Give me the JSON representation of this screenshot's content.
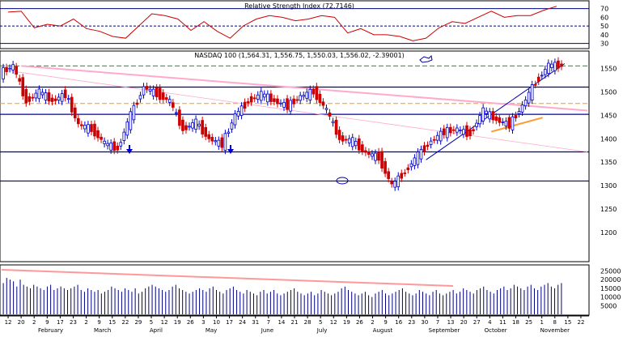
{
  "chart_data": [
    {
      "type": "line",
      "title": "Relative Strength Index (72.7146)",
      "ylim": [
        25,
        78
      ],
      "y_ticks": [
        30,
        40,
        50,
        60,
        70
      ],
      "reference_lines": [
        30,
        50,
        70
      ],
      "series": [
        {
          "color": "#cc0000",
          "x": [
            "2006-01-12",
            "2006-01-20",
            "2006-02-02",
            "2006-02-09",
            "2006-02-17",
            "2006-02-23",
            "2006-03-02",
            "2006-03-09",
            "2006-03-15",
            "2006-03-22",
            "2006-03-29",
            "2006-04-05",
            "2006-04-12",
            "2006-04-19",
            "2006-04-26",
            "2006-05-03",
            "2006-05-10",
            "2006-05-17",
            "2006-05-24",
            "2006-05-31",
            "2006-06-07",
            "2006-06-14",
            "2006-06-21",
            "2006-06-28",
            "2006-07-05",
            "2006-07-12",
            "2006-07-19",
            "2006-07-26",
            "2006-08-02",
            "2006-08-09",
            "2006-08-16",
            "2006-08-23",
            "2006-08-30",
            "2006-09-06",
            "2006-09-13",
            "2006-09-20",
            "2006-09-27",
            "2006-10-04",
            "2006-10-11",
            "2006-10-18",
            "2006-10-25",
            "2006-11-01",
            "2006-11-08"
          ],
          "values": [
            66,
            67,
            48,
            52,
            50,
            58,
            47,
            44,
            38,
            36,
            50,
            64,
            62,
            58,
            45,
            55,
            44,
            36,
            50,
            58,
            62,
            60,
            56,
            58,
            62,
            60,
            42,
            47,
            40,
            40,
            38,
            33,
            36,
            48,
            55,
            53,
            60,
            67,
            60,
            62,
            62,
            68,
            72.7
          ]
        }
      ]
    },
    {
      "type": "line",
      "title": "NASDAQ 100 (1,564.31, 1,556.75, 1,550.03, 1,556.02, -2.39001)",
      "ylim": [
        1140,
        1585
      ],
      "y_ticks": [
        1200,
        1250,
        1300,
        1350,
        1400,
        1450,
        1500,
        1550
      ],
      "horizontal_levels": [
        {
          "value": 1555,
          "color": "#00aa00",
          "style": "dashed"
        },
        {
          "value": 1510,
          "color": "#0000aa",
          "style": "solid"
        },
        {
          "value": 1475,
          "color": "#ff9900",
          "style": "dashed"
        },
        {
          "value": 1452,
          "color": "#0000aa",
          "style": "solid"
        },
        {
          "value": 1372,
          "color": "#0000aa",
          "style": "solid"
        },
        {
          "value": 1310,
          "color": "#0000aa",
          "style": "solid"
        }
      ],
      "series": [
        {
          "x": [
            "2006-01-12",
            "2006-01-20",
            "2006-02-02",
            "2006-02-09",
            "2006-02-17",
            "2006-02-23",
            "2006-03-02",
            "2006-03-09",
            "2006-03-15",
            "2006-03-22",
            "2006-03-29",
            "2006-04-05",
            "2006-04-12",
            "2006-04-19",
            "2006-04-26",
            "2006-05-03",
            "2006-05-10",
            "2006-05-17",
            "2006-05-24",
            "2006-05-31",
            "2006-06-07",
            "2006-06-14",
            "2006-06-21",
            "2006-06-28",
            "2006-07-05",
            "2006-07-12",
            "2006-07-19",
            "2006-07-26",
            "2006-08-02",
            "2006-08-09",
            "2006-08-16",
            "2006-08-23",
            "2006-08-30",
            "2006-09-06",
            "2006-09-13",
            "2006-09-20",
            "2006-09-27",
            "2006-10-04",
            "2006-10-11",
            "2006-10-18",
            "2006-10-25",
            "2006-11-01",
            "2006-11-08"
          ],
          "values": [
            1540,
            1555,
            1480,
            1500,
            1480,
            1495,
            1430,
            1420,
            1390,
            1378,
            1450,
            1510,
            1495,
            1480,
            1420,
            1435,
            1400,
            1388,
            1450,
            1480,
            1495,
            1480,
            1470,
            1490,
            1500,
            1460,
            1400,
            1395,
            1370,
            1360,
            1300,
            1330,
            1365,
            1395,
            1415,
            1420,
            1410,
            1460,
            1440,
            1430,
            1470,
            1520,
            1556
          ]
        }
      ]
    },
    {
      "type": "bar",
      "title": "",
      "ylim": [
        0,
        28000
      ],
      "y_ticks": [
        5000,
        10000,
        15000,
        20000,
        25000
      ],
      "series": [
        {
          "values": [
            18000,
            21000,
            20000,
            19000,
            16000,
            20000,
            17000,
            16000,
            15000,
            17000,
            16000,
            15000,
            14000,
            16000,
            17000,
            14000,
            15000,
            16000,
            15000,
            14000,
            15000,
            16000,
            17000,
            14000,
            13000,
            15000,
            14000,
            13000,
            14000,
            12000,
            13000,
            14000,
            16000,
            15000,
            14000,
            13000,
            15000,
            14000,
            13000,
            15000,
            12000,
            13000,
            15000,
            16000,
            17000,
            16000,
            15000,
            14000,
            13000,
            14000,
            16000,
            17000,
            15000,
            14000,
            13000,
            12000,
            13000,
            14000,
            15000,
            14000,
            13000,
            15000,
            16000,
            14000,
            13000,
            12000,
            14000,
            15000,
            16000,
            14000,
            13000,
            12000,
            14000,
            13000,
            12000,
            11000,
            13000,
            14000,
            12000,
            13000,
            14000,
            12000,
            11000,
            12000,
            13000,
            14000,
            15000,
            13000,
            12000,
            11000,
            12000,
            13000,
            11000,
            12000,
            14000,
            13000,
            12000,
            11000,
            12000,
            13000,
            15000,
            16000,
            14000,
            13000,
            12000,
            11000,
            12000,
            13000,
            11000,
            10000,
            12000,
            13000,
            14000,
            12000,
            11000,
            12000,
            13000,
            14000,
            15000,
            13000,
            12000,
            11000,
            12000,
            14000,
            13000,
            12000,
            11000,
            13000,
            14000,
            12000,
            11000,
            12000,
            13000,
            14000,
            12000,
            13000,
            15000,
            14000,
            13000,
            12000,
            14000,
            15000,
            16000,
            14000,
            13000,
            12000,
            14000,
            15000,
            16000,
            14000,
            15000,
            17000,
            16000,
            15000,
            14000,
            16000,
            17000,
            15000,
            14000,
            16000,
            17000,
            18000,
            16000,
            15000,
            17000,
            18000
          ]
        }
      ]
    }
  ],
  "x_axis": {
    "day_ticks": [
      "12",
      "20",
      "2",
      "9",
      "17",
      "23",
      "2",
      "9",
      "15",
      "22",
      "29",
      "5",
      "12",
      "19",
      "26",
      "3",
      "10",
      "17",
      "24",
      "31",
      "7",
      "14",
      "21",
      "28",
      "5",
      "12",
      "19",
      "26",
      "2",
      "9",
      "16",
      "23",
      "30",
      "7",
      "13",
      "20",
      "27",
      "4",
      "11",
      "18",
      "25",
      "1",
      "8",
      "15",
      "22"
    ],
    "months": [
      "February",
      "March",
      "April",
      "May",
      "June",
      "July",
      "August",
      "September",
      "October",
      "November"
    ]
  }
}
